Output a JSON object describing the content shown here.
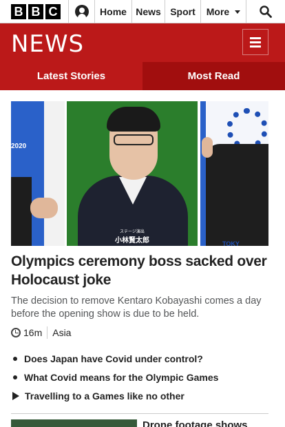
{
  "nav": {
    "logo_letters": [
      "B",
      "B",
      "C"
    ],
    "account_icon": "account-icon",
    "items": [
      {
        "label": "Home"
      },
      {
        "label": "News"
      },
      {
        "label": "Sport"
      },
      {
        "label": "More"
      }
    ],
    "search_icon": "search-icon"
  },
  "banner": {
    "title": "NEWS",
    "menu_icon": "hamburger-icon",
    "color": "#bb1919"
  },
  "tabs": [
    {
      "label": "Latest Stories",
      "color": "#bb1919"
    },
    {
      "label": "Most Read",
      "color": "#a10e0e"
    }
  ],
  "story": {
    "image_caption_small": "ステージ演出",
    "image_caption": "小林賢太郎",
    "image_text_left": "2020",
    "image_text_right": "TOKY",
    "headline": "Olympics ceremony boss sacked over Holocaust joke",
    "summary": "The decision to remove Kentaro Kobayashi comes a day before the opening show is due to be held.",
    "time": "16m",
    "region": "Asia",
    "related": [
      {
        "label": "Does Japan have Covid under control?",
        "icon": "bullet"
      },
      {
        "label": "What Covid means for the Olympic Games",
        "icon": "bullet"
      },
      {
        "label": "Travelling to a Games like no other",
        "icon": "play-icon"
      }
    ]
  },
  "next_story": {
    "headline": "Drone footage shows"
  }
}
